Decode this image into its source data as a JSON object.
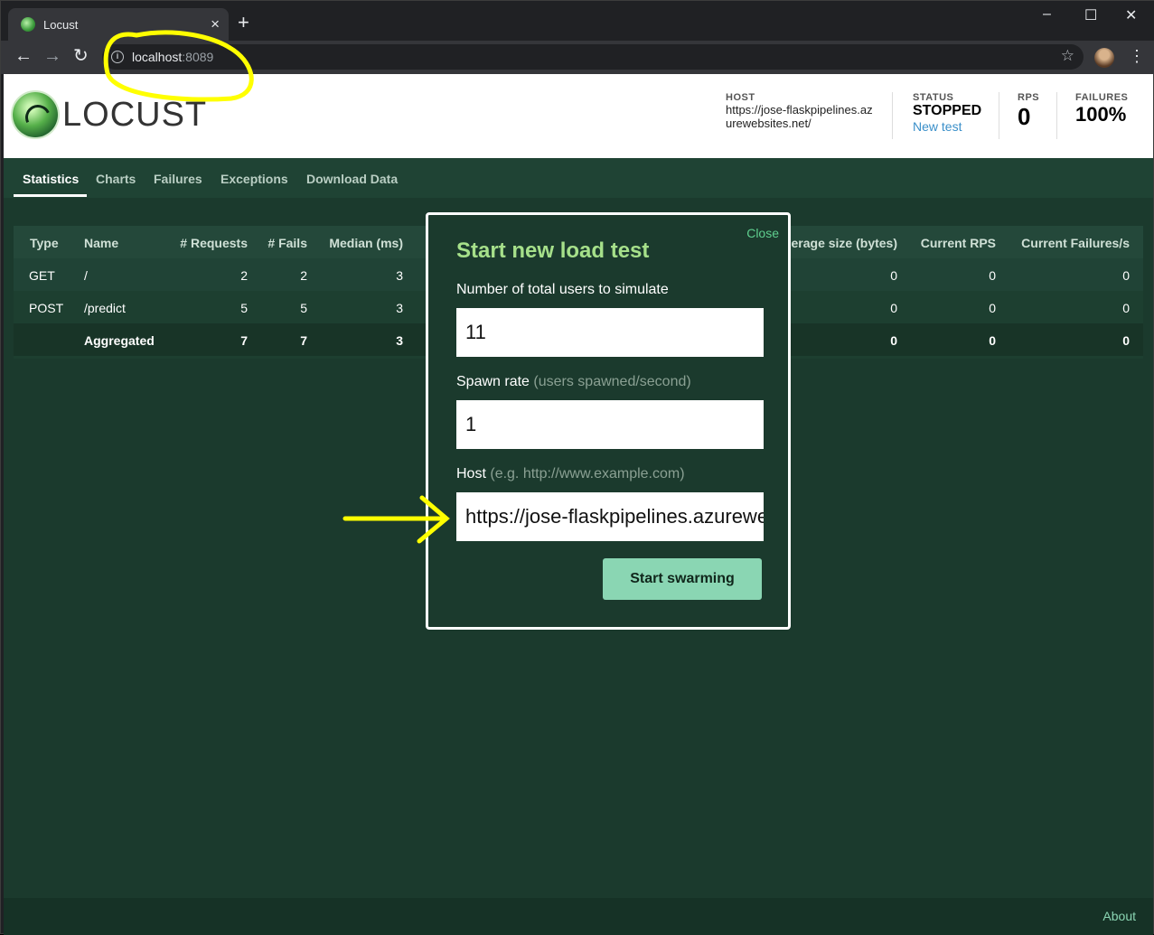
{
  "browser": {
    "tab_title": "Locust",
    "new_tab": "+",
    "url_host": "localhost",
    "url_port": ":8089",
    "window_controls": [
      "–",
      "☐",
      "✕"
    ]
  },
  "app": {
    "logo_text": "LOCUST",
    "host_label": "HOST",
    "host_value": "https://jose-flaskpipelines.azurewebsites.net/",
    "status_label": "STATUS",
    "status_value": "STOPPED",
    "new_test_link": "New test",
    "rps_label": "RPS",
    "rps_value": "0",
    "failures_label": "FAILURES",
    "failures_value": "100%"
  },
  "nav": {
    "tabs": [
      "Statistics",
      "Charts",
      "Failures",
      "Exceptions",
      "Download Data"
    ],
    "active": "Statistics"
  },
  "table": {
    "headers": [
      "Type",
      "Name",
      "# Requests",
      "# Fails",
      "Median (ms)",
      "erage size (bytes)",
      "Current RPS",
      "Current Failures/s"
    ],
    "rows": [
      {
        "type": "GET",
        "name": "/",
        "requests": "2",
        "fails": "2",
        "median": "3",
        "avg_size": "0",
        "rps": "0",
        "fails_s": "0"
      },
      {
        "type": "POST",
        "name": "/predict",
        "requests": "5",
        "fails": "5",
        "median": "3",
        "avg_size": "0",
        "rps": "0",
        "fails_s": "0"
      },
      {
        "type": "",
        "name": "Aggregated",
        "requests": "7",
        "fails": "7",
        "median": "3",
        "avg_size": "0",
        "rps": "0",
        "fails_s": "0"
      }
    ]
  },
  "modal": {
    "close": "Close",
    "title": "Start new load test",
    "users_label": "Number of total users to simulate",
    "users_value": "11",
    "spawn_label": "Spawn rate",
    "spawn_hint": "(users spawned/second)",
    "spawn_value": "1",
    "host_label": "Host",
    "host_hint": "(e.g. http://www.example.com)",
    "host_value": "https://jose-flaskpipelines.azurewebsites.net/",
    "submit": "Start swarming"
  },
  "footer": {
    "about": "About"
  },
  "colors": {
    "page_bg": "#1b3a2d",
    "accent_green": "#a6e08a",
    "button_green": "#8ad6b3",
    "annotation_yellow": "#ffff00"
  }
}
